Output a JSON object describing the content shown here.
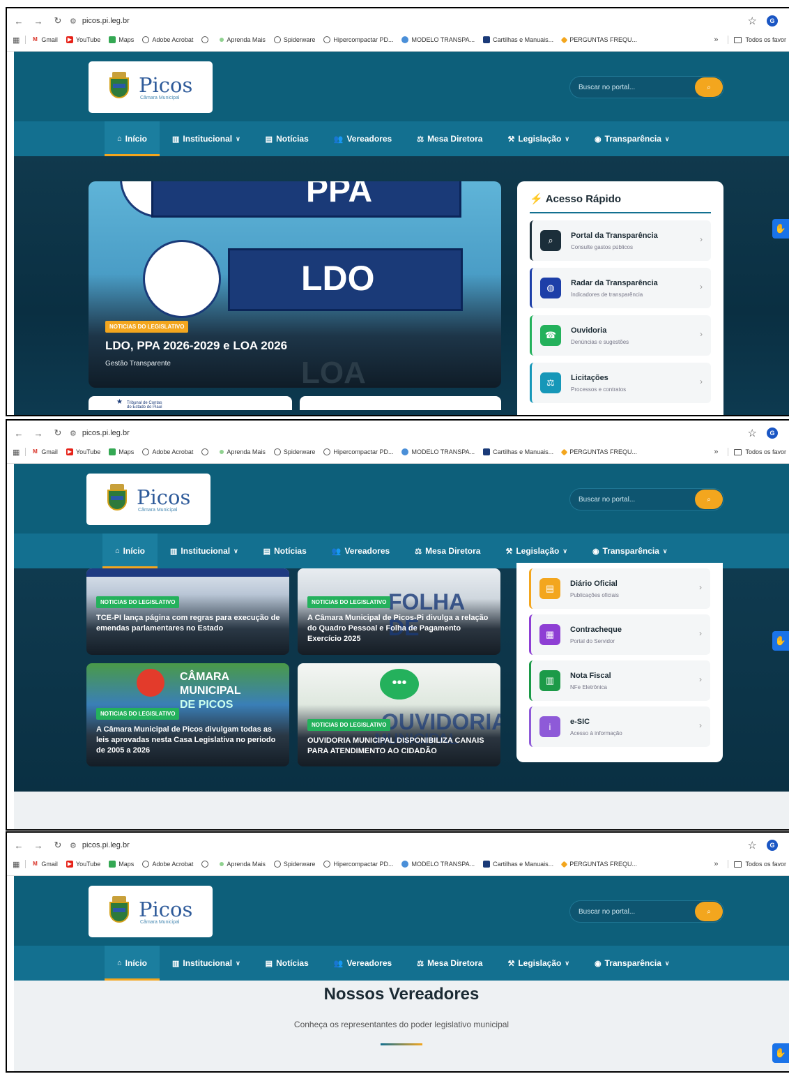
{
  "browser": {
    "url": "picos.pi.leg.br",
    "profile_initial": "G",
    "bookmarks": [
      "Gmail",
      "YouTube",
      "Maps",
      "Adobe Acrobat",
      "Aprenda Mais",
      "Spiderware",
      "Hipercompactar PD...",
      "MODELO TRANSPA...",
      "Cartilhas e Manuais...",
      "PERGUNTAS FREQU..."
    ],
    "more": "»",
    "all_bookmarks": "Todos os favor"
  },
  "site": {
    "logo_title": "Picos",
    "logo_sub": "Câmara Municipal",
    "search_placeholder": "Buscar no portal...",
    "nav": [
      "Início",
      "Institucional",
      "Notícias",
      "Vereadores",
      "Mesa Diretora",
      "Legislação",
      "Transparência"
    ]
  },
  "featured": {
    "tag": "NOTICIAS DO LEGISLATIVO",
    "title": "LDO, PPA 2026-2029 e LOA 2026",
    "subtitle": "Gestão Transparente",
    "img_text_1": "PPA",
    "img_text_2": "LDO",
    "img_text_3": "LOA"
  },
  "quick_access": {
    "title": "Acesso Rápido",
    "items": [
      {
        "title": "Portal da Transparência",
        "sub": "Consulte gastos públicos",
        "color": "#1b2e3a"
      },
      {
        "title": "Radar da Transparência",
        "sub": "Indicadores de transparência",
        "color": "#1d3fa8"
      },
      {
        "title": "Ouvidoria",
        "sub": "Denúncias e sugestões",
        "color": "#24b15c"
      },
      {
        "title": "Licitações",
        "sub": "Processos e contratos",
        "color": "#1697b8"
      },
      {
        "title": "Diário Oficial",
        "sub": "Publicações oficiais",
        "color": "#f3a61e"
      },
      {
        "title": "Contracheque",
        "sub": "Portal do Servidor",
        "color": "#8e3fd4"
      },
      {
        "title": "Nota Fiscal",
        "sub": "NFe Eletrônica",
        "color": "#1c9a48"
      },
      {
        "title": "e-SIC",
        "sub": "Acesso à informação",
        "color": "#8e5ad8"
      }
    ]
  },
  "news": [
    {
      "tag": "NOTICIAS DO LEGISLATIVO",
      "title": "TCE-PI lança página com regras para execução de emendas parlamentares no Estado"
    },
    {
      "tag": "NOTICIAS DO LEGISLATIVO",
      "title": "A Câmara Municipal de Picos-Pi divulga a relação do Quadro Pessoal e Folha de Pagamento Exercício 2025"
    },
    {
      "tag": "NOTICIAS DO LEGISLATIVO",
      "title": "A Câmara Municipal de Picos divulgam todas as leis aprovadas nesta Casa Legislativa no periodo de 2005 a 2026"
    },
    {
      "tag": "NOTICIAS DO LEGISLATIVO",
      "title": "OUVIDORIA MUNICIPAL DISPONIBILIZA CANAIS PARA ATENDIMENTO AO CIDADÃO"
    }
  ],
  "news_img_text": {
    "camara_1": "CÂMARA",
    "camara_2": "MUNICIPAL",
    "camara_3": "DE PICOS",
    "folha": "FOLHA DE",
    "ouvidoria": "OUVIDORIA",
    "municipal": "MUNICIPAL",
    "tce_1": "Tribunal de Contas",
    "tce_2": "do Estado do Piauí"
  },
  "vereadores": {
    "title": "Nossos Vereadores",
    "subtitle": "Conheça os representantes do poder legislativo municipal"
  }
}
